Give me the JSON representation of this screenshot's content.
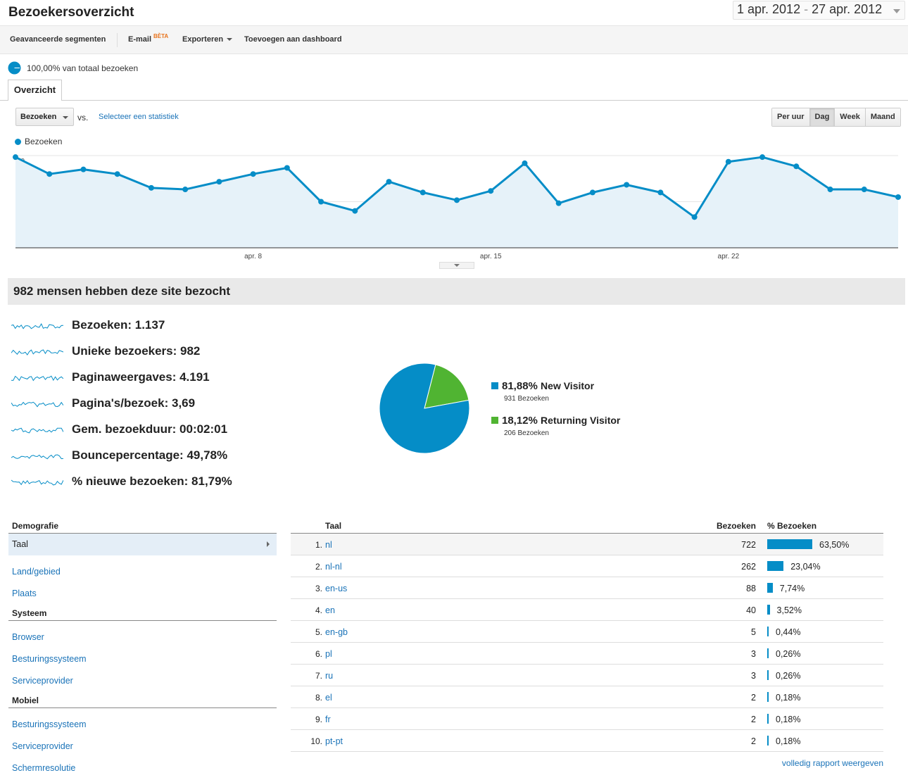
{
  "header": {
    "title": "Bezoekersoverzicht",
    "date_start": "1 apr. 2012",
    "date_sep": " - ",
    "date_end": "27 apr. 2012"
  },
  "toolbar": {
    "advanced_segments": "Geavanceerde segmenten",
    "email": "E-mail",
    "beta": "BÈTA",
    "export": "Exporteren",
    "add_dashboard": "Toevoegen aan dashboard"
  },
  "segment": {
    "label": "100,00% van totaal bezoeken"
  },
  "tabs": {
    "overview": "Overzicht"
  },
  "controls": {
    "metric": "Bezoeken",
    "vs": "vs.",
    "compare": "Selecteer een statistiek",
    "periods": [
      "Per uur",
      "Dag",
      "Week",
      "Maand"
    ],
    "active_period": "Dag"
  },
  "chart_data": {
    "type": "line",
    "series": [
      {
        "name": "Bezoeken",
        "x": [
          "1 apr",
          "2 apr",
          "3 apr",
          "4 apr",
          "5 apr",
          "6 apr",
          "7 apr",
          "8 apr",
          "9 apr",
          "10 apr",
          "11 apr",
          "12 apr",
          "13 apr",
          "14 apr",
          "15 apr",
          "16 apr",
          "17 apr",
          "18 apr",
          "19 apr",
          "20 apr",
          "21 apr",
          "22 apr",
          "23 apr",
          "24 apr",
          "25 apr",
          "26 apr",
          "27 apr"
        ],
        "values": [
          59,
          48,
          51,
          48,
          39,
          38,
          43,
          48,
          52,
          30,
          24,
          43,
          36,
          31,
          37,
          55,
          29,
          36,
          41,
          36,
          20,
          56,
          59,
          53,
          38,
          38,
          33
        ]
      }
    ],
    "y_ticks": [
      "30",
      "60"
    ],
    "ylim": [
      0,
      60
    ],
    "x_ticks": [
      "apr. 8",
      "apr. 15",
      "apr. 22"
    ],
    "color": "#058dc7",
    "fill": "#e6f2f9",
    "grid": true,
    "legend": "top-left"
  },
  "summary": {
    "title": "982 mensen hebben deze site bezocht",
    "stats": [
      {
        "label": "Bezoeken:",
        "value": "1.137"
      },
      {
        "label": "Unieke bezoekers:",
        "value": "982"
      },
      {
        "label": "Paginaweergaves:",
        "value": "4.191"
      },
      {
        "label": "Pagina's/bezoek:",
        "value": "3,69"
      },
      {
        "label": "Gem. bezoekduur:",
        "value": "00:02:01"
      },
      {
        "label": "Bouncepercentage:",
        "value": "49,78%"
      },
      {
        "label": "% nieuwe bezoeken:",
        "value": "81,79%"
      }
    ]
  },
  "pie": {
    "type": "pie",
    "slices": [
      {
        "pct_label": "81,88%",
        "name": "New Visitor",
        "sub": "931 Bezoeken",
        "value": 81.88,
        "color": "#058dc7"
      },
      {
        "pct_label": "18,12%",
        "name": "Returning Visitor",
        "sub": "206 Bezoeken",
        "value": 18.12,
        "color": "#50b432"
      }
    ]
  },
  "nav": {
    "sections": [
      {
        "title": "Demografie",
        "items": [
          "Taal",
          "Land/gebied",
          "Plaats"
        ]
      },
      {
        "title": "Systeem",
        "items": [
          "Browser",
          "Besturingssysteem",
          "Serviceprovider"
        ]
      },
      {
        "title": "Mobiel",
        "items": [
          "Besturingssysteem",
          "Serviceprovider",
          "Schermresolutie"
        ]
      }
    ],
    "selected": "Taal"
  },
  "table": {
    "headers": {
      "dimension": "Taal",
      "visits": "Bezoeken",
      "pct": "% Bezoeken"
    },
    "rows": [
      {
        "idx": "1.",
        "lang": "nl",
        "visits": "722",
        "pct": "63,50%",
        "share": 63.5
      },
      {
        "idx": "2.",
        "lang": "nl-nl",
        "visits": "262",
        "pct": "23,04%",
        "share": 23.04
      },
      {
        "idx": "3.",
        "lang": "en-us",
        "visits": "88",
        "pct": "7,74%",
        "share": 7.74
      },
      {
        "idx": "4.",
        "lang": "en",
        "visits": "40",
        "pct": "3,52%",
        "share": 3.52
      },
      {
        "idx": "5.",
        "lang": "en-gb",
        "visits": "5",
        "pct": "0,44%",
        "share": 0.44
      },
      {
        "idx": "6.",
        "lang": "pl",
        "visits": "3",
        "pct": "0,26%",
        "share": 0.26
      },
      {
        "idx": "7.",
        "lang": "ru",
        "visits": "3",
        "pct": "0,26%",
        "share": 0.26
      },
      {
        "idx": "8.",
        "lang": "el",
        "visits": "2",
        "pct": "0,18%",
        "share": 0.18
      },
      {
        "idx": "9.",
        "lang": "fr",
        "visits": "2",
        "pct": "0,18%",
        "share": 0.18
      },
      {
        "idx": "10.",
        "lang": "pt-pt",
        "visits": "2",
        "pct": "0,18%",
        "share": 0.18
      }
    ],
    "full_report": "volledig rapport weergeven"
  }
}
